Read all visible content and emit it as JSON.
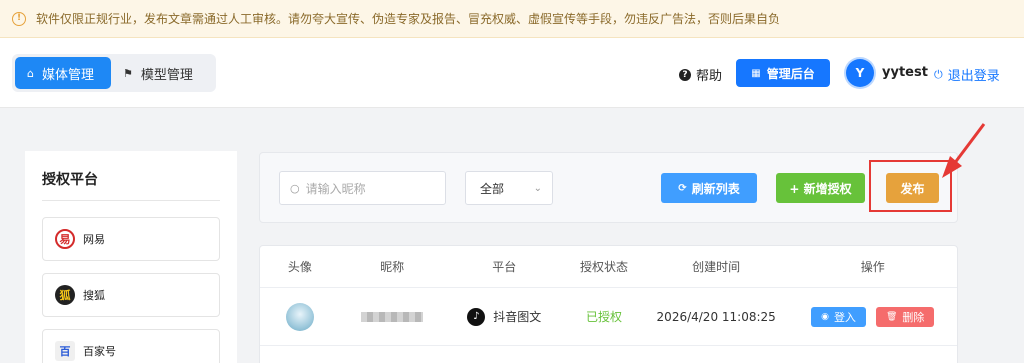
{
  "notice": {
    "text": "软件仅限正规行业，发布文章需通过人工审核。请勿夸大宣传、伪造专家及报告、冒充权威、虚假宣传等手段，勿违反广告法，否则后果自负"
  },
  "header": {
    "tabs": [
      {
        "label": "媒体管理",
        "icon": "home-icon",
        "active": true
      },
      {
        "label": "模型管理",
        "icon": "flag-icon",
        "active": false
      }
    ],
    "help_label": "帮助",
    "admin_label": "管理后台",
    "avatar_letter": "Y",
    "username": "yytest",
    "logout_label": "退出登录"
  },
  "left_panel": {
    "title": "授权平台",
    "platforms": [
      {
        "name": "网易",
        "logo": "易"
      },
      {
        "name": "搜狐",
        "logo": "狐"
      },
      {
        "name": "百家号",
        "logo": "百"
      }
    ]
  },
  "toolbar": {
    "search_placeholder": "请输入昵称",
    "filter_value": "全部",
    "refresh_label": "刷新列表",
    "add_label": "+ 新增授权",
    "publish_label": "发布"
  },
  "table": {
    "columns": [
      "头像",
      "昵称",
      "平台",
      "授权状态",
      "创建时间",
      "操作"
    ],
    "rows": [
      {
        "platform": "抖音图文",
        "status": "已授权",
        "created": "2026/4/20 11:08:25",
        "login_label": "登入",
        "delete_label": "删除"
      }
    ]
  },
  "colors": {
    "primary": "#1677ff",
    "success": "#67c23a",
    "warning": "#e6a23c",
    "danger": "#f56c6c",
    "highlight": "#e53935"
  }
}
